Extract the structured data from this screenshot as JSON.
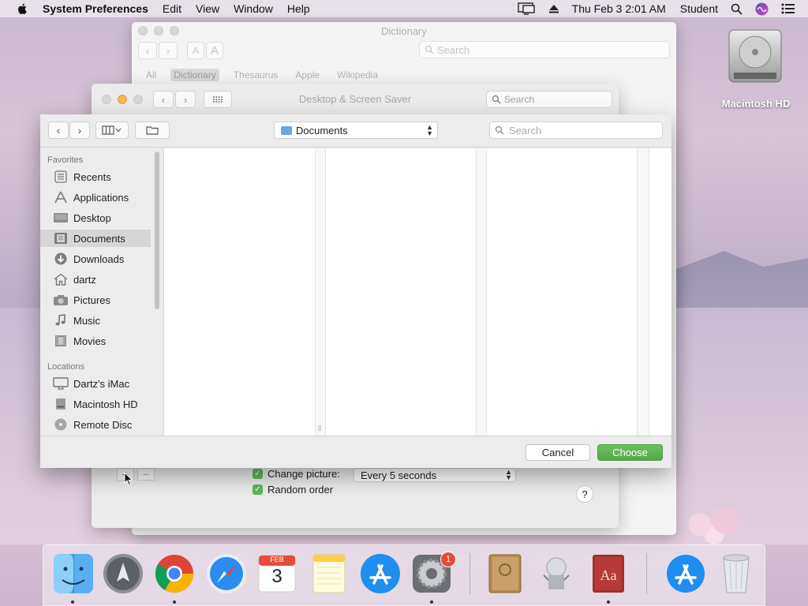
{
  "menubar": {
    "app_name": "System Preferences",
    "items": [
      "Edit",
      "View",
      "Window",
      "Help"
    ],
    "clock": "Thu Feb 3  2:01 AM",
    "user": "Student"
  },
  "desktop": {
    "disk_label": "Macintosh HD"
  },
  "dictionary_window": {
    "title": "Dictionary",
    "search_placeholder": "Search",
    "font_small": "A",
    "font_large": "A",
    "tabs": [
      "All",
      "Dictionary",
      "Thesaurus",
      "Apple",
      "Wikipedia"
    ],
    "active_tab": "Dictionary"
  },
  "desktop_screensaver_window": {
    "title": "Desktop & Screen Saver",
    "search_placeholder": "Search",
    "add_label": "+",
    "remove_label": "−",
    "change_picture_label": "Change picture:",
    "change_picture_value": "Every 5 seconds",
    "random_order_label": "Random order",
    "help_label": "?"
  },
  "open_sheet": {
    "location": "Documents",
    "search_placeholder": "Search",
    "sidebar": {
      "favorites_header": "Favorites",
      "favorites": [
        "Recents",
        "Applications",
        "Desktop",
        "Documents",
        "Downloads",
        "dartz",
        "Pictures",
        "Music",
        "Movies"
      ],
      "selected": "Documents",
      "locations_header": "Locations",
      "locations": [
        "Dartz's iMac",
        "Macintosh HD",
        "Remote Disc"
      ]
    },
    "cancel_label": "Cancel",
    "choose_label": "Choose"
  },
  "dock": {
    "apps": [
      "Finder",
      "Launchpad",
      "Google Chrome",
      "Safari",
      "Calendar",
      "Notes",
      "App Store",
      "System Preferences",
      "Contacts",
      "Automator",
      "Dictionary",
      "App Store Downloads",
      "Trash"
    ],
    "calendar_month": "FEB",
    "calendar_day": "3",
    "sysprefs_badge": "1"
  },
  "colors": {
    "accent_green": "#5cb356",
    "folder_blue": "#6aa6e5",
    "badge_red": "#e8483f"
  }
}
